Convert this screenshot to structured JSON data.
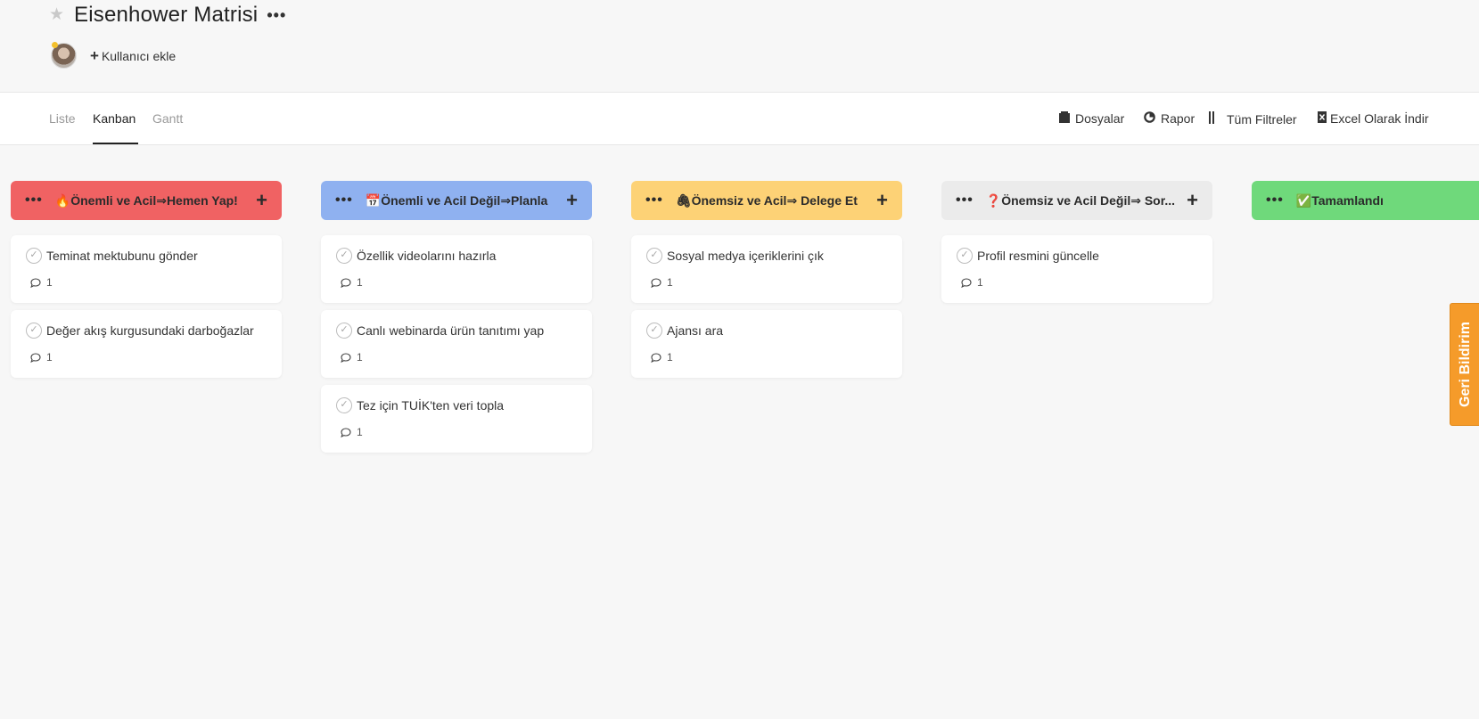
{
  "header": {
    "title": "Eisenhower Matrisi",
    "title_menu": "•••",
    "add_user_label": "Kullanıcı ekle"
  },
  "tabs": [
    {
      "label": "Liste"
    },
    {
      "label": "Kanban"
    },
    {
      "label": "Gantt"
    }
  ],
  "toolbar": {
    "files": "Dosyalar",
    "report": "Rapor",
    "filters": "Tüm Filtreler",
    "excel": "Excel Olarak İndir"
  },
  "columns": [
    {
      "title": "🔥Önemli ve Acil⇒Hemen Yap!",
      "color": "#f06263",
      "cards": [
        {
          "task": "Teminat mektubunu gönder",
          "comments": "1"
        },
        {
          "task": "Değer akış kurgusundaki darboğazlar",
          "comments": "1"
        }
      ]
    },
    {
      "title": "📅Önemli ve Acil Değil⇒Planla",
      "color": "#8fb1f0",
      "cards": [
        {
          "task": "Özellik videolarını hazırla",
          "comments": "1"
        },
        {
          "task": "Canlı webinarda ürün tanıtımı yap",
          "comments": "1"
        },
        {
          "task": "Tez için TUİK'ten veri topla",
          "comments": "1"
        }
      ]
    },
    {
      "title": "🖇Önemsiz ve Acil⇒ Delege Et",
      "color": "#fdd276",
      "cards": [
        {
          "task": "Sosyal medya içeriklerini çık",
          "comments": "1"
        },
        {
          "task": "Ajansı ara",
          "comments": "1"
        }
      ]
    },
    {
      "title": "❓Önemsiz ve Acil Değil⇒ Sor...",
      "color": "#ebebeb",
      "cards": [
        {
          "task": "Profil resmini güncelle",
          "comments": "1"
        }
      ]
    },
    {
      "title": "✅Tamamlandı",
      "color": "#6fd97b",
      "cards": []
    }
  ],
  "feedback_label": "Geri Bildirim"
}
